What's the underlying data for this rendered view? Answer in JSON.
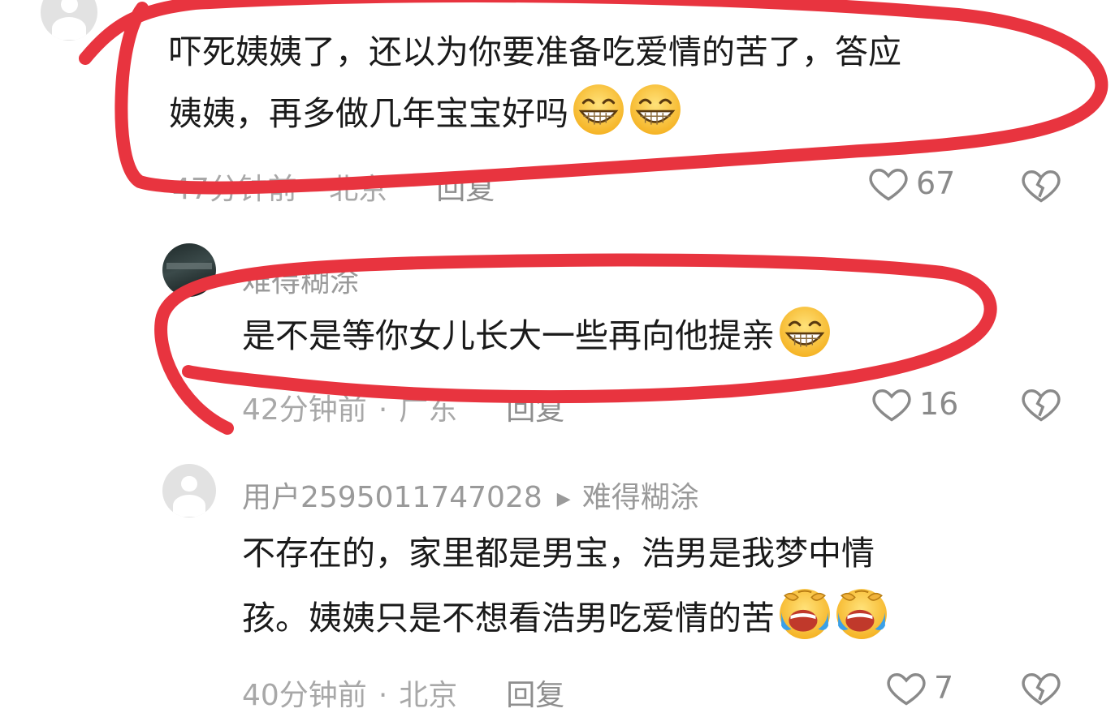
{
  "comments": [
    {
      "text_line1": "吓死姨姨了，还以为你要准备吃爱情的苦了，答应",
      "text_line2": "姨姨，再多做几年宝宝好吗",
      "emojis": [
        "grin-emoji",
        "grin-emoji"
      ],
      "time": "47分钟前",
      "location": "北京",
      "reply_label": "回复",
      "likes": "67"
    },
    {
      "username": "难得糊涂",
      "text_line1": "是不是等你女儿长大一些再向他提亲",
      "emojis": [
        "grin-emoji"
      ],
      "time": "42分钟前",
      "location": "广东",
      "reply_label": "回复",
      "likes": "16"
    },
    {
      "username": "用户2595011747028",
      "reply_to": "难得糊涂",
      "text_line1": "不存在的，家里都是男宝，浩男是我梦中情",
      "text_line2": "孩。姨姨只是不想看浩男吃爱情的苦",
      "emojis": [
        "laugh-cry-emoji",
        "laugh-cry-emoji"
      ],
      "time": "40分钟前",
      "location": "北京",
      "reply_label": "回复",
      "likes": "7"
    }
  ],
  "colors": {
    "highlight_stroke": "#e8343f",
    "meta_text": "#a8a8a8",
    "body_text": "#1a1a1a"
  }
}
